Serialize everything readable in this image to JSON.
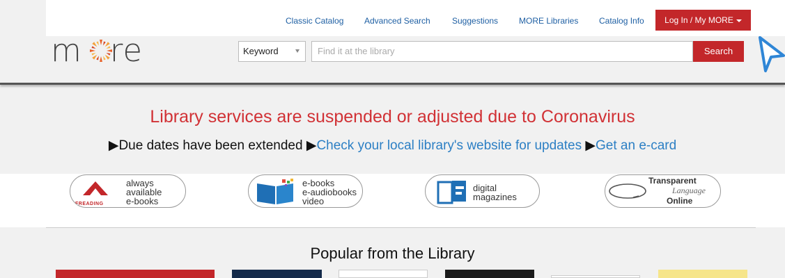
{
  "nav": {
    "classic_catalog": "Classic Catalog",
    "advanced_search": "Advanced Search",
    "suggestions": "Suggestions",
    "more_libraries": "MORE Libraries",
    "catalog_info": "Catalog Info",
    "login": "Log In / My MORE"
  },
  "logo": {
    "text_m": "m",
    "text_re": "re"
  },
  "search": {
    "type_selected": "Keyword",
    "placeholder": "Find it at the library",
    "button": "Search"
  },
  "alert": {
    "title": "Library services are suspended or adjusted due to Coronavirus",
    "item1": "Due dates have been extended",
    "item2": "Check your local library's website for updates",
    "item3": "Get an e-card"
  },
  "services": {
    "freading": {
      "logo_text": "FREADING",
      "line1": "always",
      "line2": "available",
      "line3": "e-books"
    },
    "ebooks": {
      "line1": "e-books",
      "line2": "e-audiobooks",
      "line3": "video"
    },
    "magazines": {
      "line1": "digital",
      "line2": "magazines"
    },
    "transparent": {
      "line1": "Transparent",
      "line2": "Language",
      "line3": "Online"
    }
  },
  "popular": {
    "title": "Popular from the Library"
  },
  "colors": {
    "brand_red": "#c3272a",
    "link_blue": "#1e5fa3",
    "alert_red": "#d13135"
  }
}
